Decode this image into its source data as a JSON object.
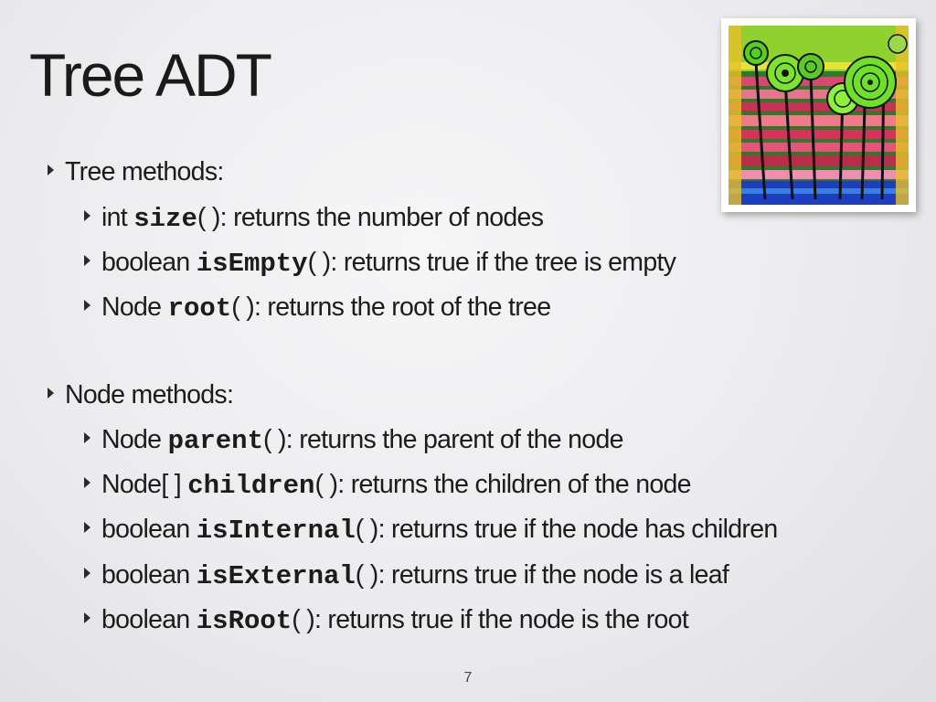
{
  "slide": {
    "title": "Tree ADT",
    "page_number": "7",
    "sections": [
      {
        "heading": "Tree methods:",
        "items": [
          {
            "type": "int",
            "method": "size",
            "parens": "( )",
            "desc": ": returns the number of nodes"
          },
          {
            "type": "boolean",
            "method": "isEmpty",
            "parens": "( )",
            "desc": ": returns true if the tree is empty"
          },
          {
            "type": "Node",
            "method": "root",
            "parens": "( )",
            "desc": ": returns the root of the tree"
          }
        ]
      },
      {
        "heading": "Node methods:",
        "items": [
          {
            "type": "Node",
            "method": "parent",
            "parens": "( )",
            "desc": ": returns the parent of the node"
          },
          {
            "type": "Node[ ]",
            "method": "children",
            "parens": "( )",
            "desc": ": returns the children of the node"
          },
          {
            "type": "boolean",
            "method": "isInternal",
            "parens": "( )",
            "desc": ": returns true if the node has children"
          },
          {
            "type": "boolean",
            "method": "isExternal",
            "parens": "( )",
            "desc": ": returns true if the node is a leaf"
          },
          {
            "type": "boolean",
            "method": "isRoot",
            "parens": "( )",
            "desc": ": returns true if the node is the root"
          }
        ]
      }
    ],
    "image": {
      "icon": "painting-trees-image"
    }
  }
}
